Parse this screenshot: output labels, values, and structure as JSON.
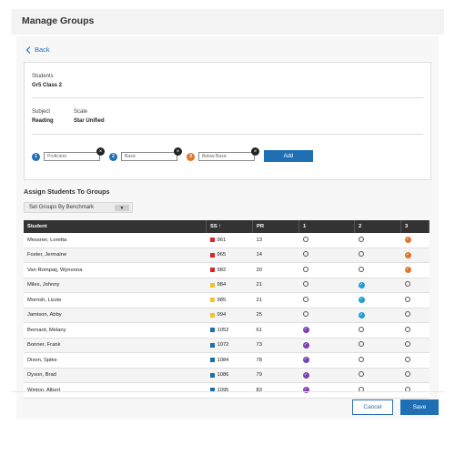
{
  "header": {
    "title": "Manage Groups"
  },
  "back": {
    "label": "Back"
  },
  "info": {
    "students_label": "Students",
    "students_value": "Gr5 Class 2",
    "subject_label": "Subject",
    "subject_value": "Reading",
    "scale_label": "Scale",
    "scale_value": "Star Unified"
  },
  "tiers": [
    {
      "num": "1",
      "placeholder": "Proficient",
      "color": "#1f6fb5"
    },
    {
      "num": "2",
      "placeholder": "Basic",
      "color": "#1f6fb5"
    },
    {
      "num": "3",
      "placeholder": "Below Basic",
      "color": "#e0742b"
    }
  ],
  "add_label": "Add",
  "assign": {
    "title": "Assign Students To Groups",
    "dropdown_value": "Set Groups By Benchmark"
  },
  "table": {
    "headers": {
      "student": "Student",
      "ss": "SS",
      "sort_icon": "sort-up-icon",
      "pr": "PR",
      "g1": "1",
      "g2": "2",
      "g3": "3"
    },
    "rows": [
      {
        "name": "Messner, Loretta",
        "ss": "961",
        "pr": "13",
        "group": 3,
        "color": "#d8262c"
      },
      {
        "name": "Foster, Jermaine",
        "ss": "965",
        "pr": "14",
        "group": 3,
        "color": "#d8262c"
      },
      {
        "name": "Van Rompaij, Wynonna",
        "ss": "982",
        "pr": "20",
        "group": 3,
        "color": "#d8262c"
      },
      {
        "name": "Miles, Johnny",
        "ss": "984",
        "pr": "21",
        "group": 2,
        "color": "#f2c12e"
      },
      {
        "name": "Morrish, Lizzie",
        "ss": "985",
        "pr": "21",
        "group": 2,
        "color": "#f2c12e"
      },
      {
        "name": "Jamison, Abby",
        "ss": "994",
        "pr": "25",
        "group": 2,
        "color": "#f2c12e"
      },
      {
        "name": "Bernard, Melany",
        "ss": "1052",
        "pr": "61",
        "group": 1,
        "color": "#1d6fa5"
      },
      {
        "name": "Bonner, Frank",
        "ss": "1072",
        "pr": "73",
        "group": 1,
        "color": "#1d6fa5"
      },
      {
        "name": "Dixon, Spike",
        "ss": "1084",
        "pr": "78",
        "group": 1,
        "color": "#1d6fa5"
      },
      {
        "name": "Dyson, Brad",
        "ss": "1086",
        "pr": "79",
        "group": 1,
        "color": "#1d6fa5"
      },
      {
        "name": "Winton, Albert",
        "ss": "1095",
        "pr": "83",
        "group": 1,
        "color": "#1d6fa5"
      }
    ]
  },
  "group_colors": {
    "1": "#7b3fb0",
    "2": "#1f9bd7",
    "3": "#e0742b"
  },
  "footer": {
    "cancel_label": "Cancel",
    "save_label": "Save"
  }
}
